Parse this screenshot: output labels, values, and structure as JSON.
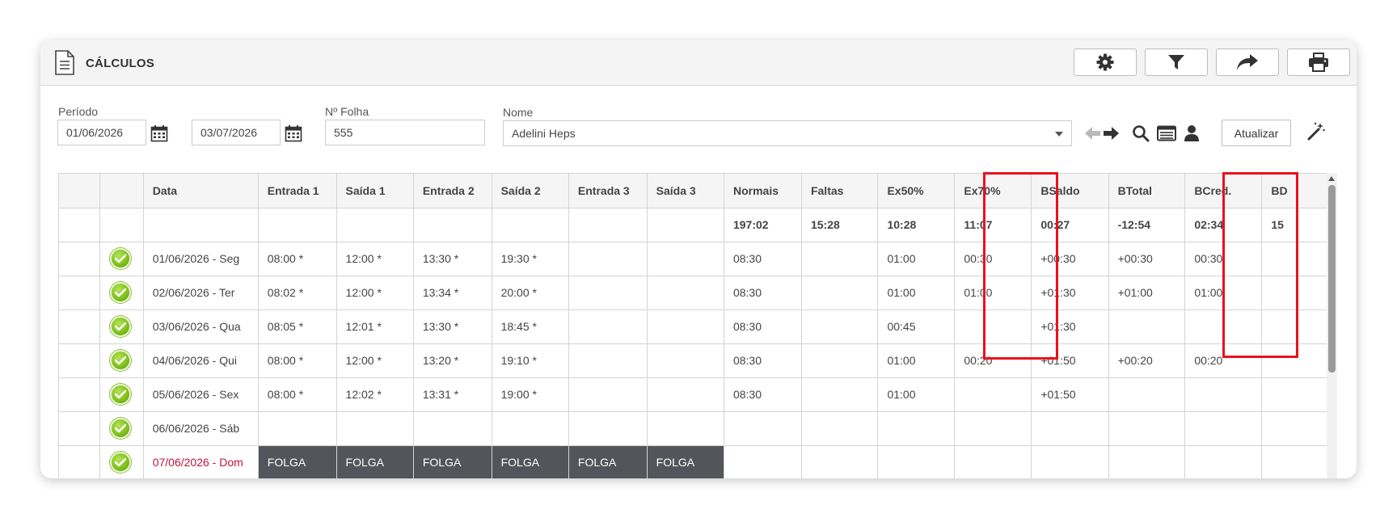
{
  "header": {
    "title": "CÁLCULOS"
  },
  "toolbar": {
    "buttons": [
      {
        "name": "settings-button",
        "icon": "gear-icon"
      },
      {
        "name": "filter-button",
        "icon": "filter-icon"
      },
      {
        "name": "share-button",
        "icon": "share-arrow-icon"
      },
      {
        "name": "print-button",
        "icon": "print-icon"
      }
    ]
  },
  "filters": {
    "periodo_label": "Período",
    "periodo_start": "01/06/2026",
    "periodo_end": "03/07/2026",
    "folha_label": "Nº Folha",
    "folha_value": "555",
    "nome_label": "Nome",
    "nome_value": "Adelini Heps",
    "atualizar_label": "Atualizar"
  },
  "grid": {
    "columns": [
      "",
      "",
      "Data",
      "Entrada 1",
      "Saída 1",
      "Entrada 2",
      "Saída 2",
      "Entrada 3",
      "Saída 3",
      "Normais",
      "Faltas",
      "Ex50%",
      "Ex70%",
      "BSaldo",
      "BTotal",
      "BCred.",
      "BD"
    ],
    "totals": [
      "",
      "",
      "",
      "",
      "",
      "",
      "",
      "",
      "",
      "197:02",
      "15:28",
      "10:28",
      "11:07",
      "00:27",
      "-12:54",
      "02:34",
      "15"
    ],
    "rows": [
      {
        "status": "ok",
        "cells": [
          "01/06/2026 - Seg",
          "08:00 *",
          "12:00 *",
          "13:30 *",
          "19:30 *",
          "",
          "",
          "08:30",
          "",
          "01:00",
          "00:30",
          "+00:30",
          "+00:30",
          "00:30",
          ""
        ]
      },
      {
        "status": "ok",
        "cells": [
          "02/06/2026 - Ter",
          "08:02 *",
          "12:00 *",
          "13:34 *",
          "20:00 *",
          "",
          "",
          "08:30",
          "",
          "01:00",
          "01:00",
          "+01:30",
          "+01:00",
          "01:00",
          ""
        ]
      },
      {
        "status": "ok",
        "cells": [
          "03/06/2026 - Qua",
          "08:05 *",
          "12:01 *",
          "13:30 *",
          "18:45 *",
          "",
          "",
          "08:30",
          "",
          "00:45",
          "",
          "+01:30",
          "",
          "",
          ""
        ]
      },
      {
        "status": "ok",
        "cells": [
          "04/06/2026 - Qui",
          "08:00 *",
          "12:00 *",
          "13:20 *",
          "19:10 *",
          "",
          "",
          "08:30",
          "",
          "01:00",
          "00:20",
          "+01:50",
          "+00:20",
          "00:20",
          ""
        ]
      },
      {
        "status": "ok",
        "cells": [
          "05/06/2026 - Sex",
          "08:00 *",
          "12:02 *",
          "13:31 *",
          "19:00 *",
          "",
          "",
          "08:30",
          "",
          "01:00",
          "",
          "+01:50",
          "",
          "",
          ""
        ]
      },
      {
        "status": "ok",
        "cells": [
          "06/06/2026 - Sáb",
          "",
          "",
          "",
          "",
          "",
          "",
          "",
          "",
          "",
          "",
          "",
          "",
          "",
          ""
        ]
      },
      {
        "status": "ok",
        "sunday": true,
        "cells": [
          "07/06/2026 - Dom",
          "FOLGA",
          "FOLGA",
          "FOLGA",
          "FOLGA",
          "FOLGA",
          "FOLGA",
          "",
          "",
          "",
          "",
          "",
          "",
          "",
          ""
        ]
      }
    ]
  },
  "colors": {
    "highlight": "#e8121e",
    "folga_bg": "#52565a",
    "sunday_text": "#c0153a",
    "check_green": "#7fc21c"
  }
}
